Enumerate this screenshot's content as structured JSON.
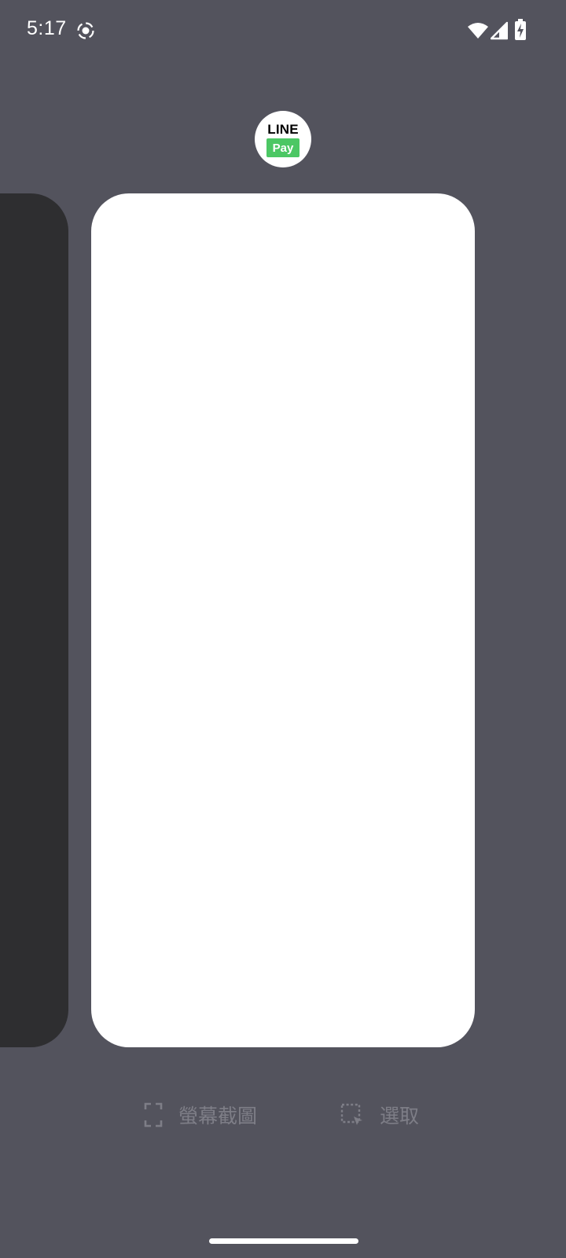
{
  "status_bar": {
    "time": "5:17",
    "icons": [
      "screen-record-icon",
      "wifi-icon",
      "cell-signal-icon",
      "battery-charging-icon"
    ]
  },
  "app": {
    "name_top": "LINE",
    "name_badge": "Pay",
    "badge_color": "#4cc764"
  },
  "actions": {
    "screenshot_label": "螢幕截圖",
    "select_label": "選取"
  },
  "colors": {
    "background": "#53535d",
    "prev_card": "#2e2e30",
    "current_card": "#ffffff",
    "action_text": "#7e7e87"
  }
}
